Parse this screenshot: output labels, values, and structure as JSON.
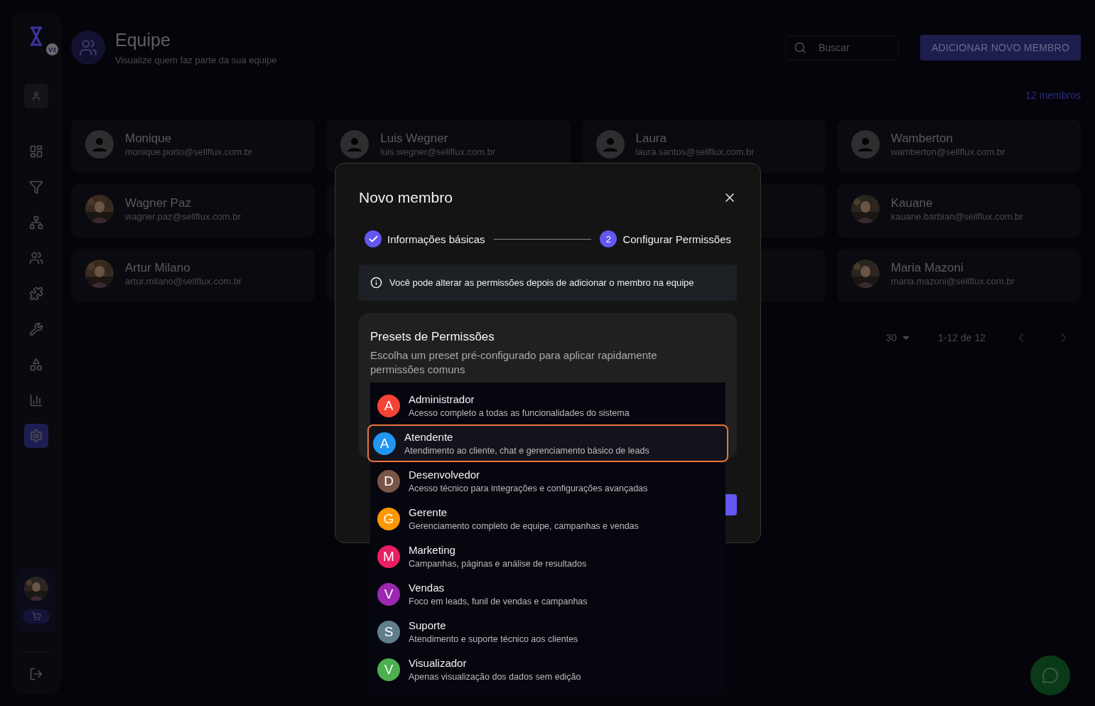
{
  "sidebar": {
    "logo_badge": "V3",
    "items": [
      {
        "selected": false
      },
      {
        "selected": false
      },
      {
        "selected": false
      },
      {
        "selected": false
      },
      {
        "selected": false
      },
      {
        "selected": false
      },
      {
        "selected": false
      },
      {
        "selected": false
      },
      {
        "selected": false
      },
      {
        "selected": true
      }
    ]
  },
  "header": {
    "title": "Equipe",
    "subtitle": "Visualize quem faz parte da sua equipe",
    "search": {
      "placeholder": "Buscar"
    },
    "add_button": "ADICIONAR NOVO MEMBRO",
    "count": "12 membros"
  },
  "members": [
    {
      "kind": "placeholder",
      "name": "Monique",
      "email": "monique.porto@sellflux.com.br"
    },
    {
      "kind": "placeholder",
      "name": "Luis Wegner",
      "email": "luis.wegner@sellflux.com.br"
    },
    {
      "kind": "placeholder",
      "name": "Laura",
      "email": "laura.santos@sellflux.com.br"
    },
    {
      "kind": "placeholder",
      "name": "Wamberton",
      "email": "wamberton@sellflux.com.br"
    },
    {
      "name": "Wagner Paz",
      "email": "wagner.paz@sellflux.com.br"
    },
    {
      "kind": "covered"
    },
    {
      "kind": "covered"
    },
    {
      "name": "Kauane",
      "email": "kauane.barbian@sellflux.com.br"
    },
    {
      "name": "Artur Milano",
      "email": "artur.milano@sellflux.com.br"
    },
    {
      "kind": "covered"
    },
    {
      "kind": "covered"
    },
    {
      "name": "Maria Mazoni",
      "email": "maria.mazoni@sellflux.com.br"
    }
  ],
  "pagination": {
    "per_page": "30",
    "range": "1-12 de 12"
  },
  "modal": {
    "title": "Novo membro",
    "steps": [
      {
        "label": "Informações básicas",
        "done": true
      },
      {
        "label": "Configurar Permissões",
        "number": "2",
        "done": false
      }
    ],
    "info": "Você pode alterar as permissões depois de adicionar o membro na equipe",
    "presets": {
      "title": "Presets de Permissões",
      "description": "Escolha um preset pré-configurado para aplicar rapidamente permissões comuns"
    }
  },
  "preset_options": [
    {
      "letter": "A",
      "name": "Administrador",
      "description": "Acesso completo a todas as funcionalidades do sistema",
      "color": "#f44336",
      "selected": false
    },
    {
      "letter": "A",
      "name": "Atendente",
      "description": "Atendimento ao cliente, chat e gerenciamento básico de leads",
      "color": "#2196f3",
      "selected": true
    },
    {
      "letter": "D",
      "name": "Desenvolvedor",
      "description": "Acesso técnico para integrações e configurações avançadas",
      "color": "#795548",
      "selected": false
    },
    {
      "letter": "G",
      "name": "Gerente",
      "description": "Gerenciamento completo de equipe, campanhas e vendas",
      "color": "#ff9800",
      "selected": false
    },
    {
      "letter": "M",
      "name": "Marketing",
      "description": "Campanhas, páginas e análise de resultados",
      "color": "#e91e63",
      "selected": false
    },
    {
      "letter": "V",
      "name": "Vendas",
      "description": "Foco em leads, funil de vendas e campanhas",
      "color": "#9c27b0",
      "selected": false
    },
    {
      "letter": "S",
      "name": "Suporte",
      "description": "Atendimento e suporte técnico aos clientes",
      "color": "#607d8b",
      "selected": false
    },
    {
      "letter": "V",
      "name": "Visualizador",
      "description": "Apenas visualização dos dados sem edição",
      "color": "#4caf50",
      "selected": false
    }
  ]
}
